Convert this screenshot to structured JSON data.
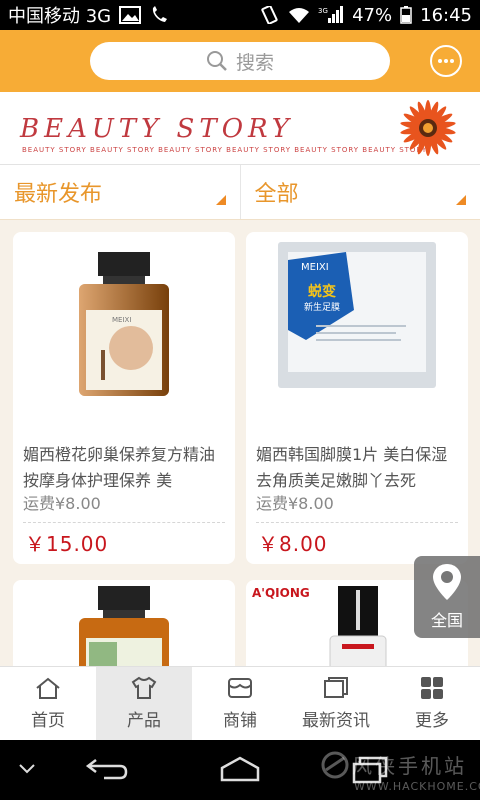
{
  "status_bar": {
    "carrier": "中国移动 3G",
    "network": "3G",
    "battery": "47%",
    "time": "16:45"
  },
  "header": {
    "search_placeholder": "搜索",
    "chat_icon": "chat-bubble-icon"
  },
  "banner": {
    "title": "BEAUTY STORY",
    "subtitle": "BEAUTY STORY BEAUTY STORY BEAUTY STORY BEAUTY STORY BEAUTY STORY BEAUTY STORY"
  },
  "filters": [
    {
      "label": "最新发布"
    },
    {
      "label": "全部"
    }
  ],
  "products": [
    {
      "name": "媚西橙花卵巢保养复方精油 按摩身体护理保养 美",
      "shipping": "运费¥8.00",
      "price": "￥15.00",
      "brand": "MEIXI"
    },
    {
      "name": "媚西韩国脚膜1片 美白保湿去角质美足嫩脚丫去死",
      "shipping": "运费¥8.00",
      "price": "￥8.00",
      "brand": "MEIXI",
      "pack_title": "蜕变",
      "pack_sub": "新生足膜"
    },
    {
      "name": "",
      "shipping": "",
      "price": "",
      "brand": ""
    },
    {
      "name": "",
      "shipping": "",
      "price": "",
      "brand": "A'QIONG"
    }
  ],
  "location_badge": {
    "label": "全国"
  },
  "tabbar": [
    {
      "label": "首页",
      "icon": "home-icon"
    },
    {
      "label": "产品",
      "icon": "shirt-icon",
      "active": true
    },
    {
      "label": "商铺",
      "icon": "shop-icon"
    },
    {
      "label": "最新资讯",
      "icon": "news-icon"
    },
    {
      "label": "更多",
      "icon": "grid-icon"
    }
  ],
  "watermark": {
    "name": "风侠手机站",
    "url": "WWW.HACKHOME.COM"
  },
  "colors": {
    "accent": "#f7ac36",
    "price": "#c8161d",
    "filter_text": "#e8962b"
  }
}
